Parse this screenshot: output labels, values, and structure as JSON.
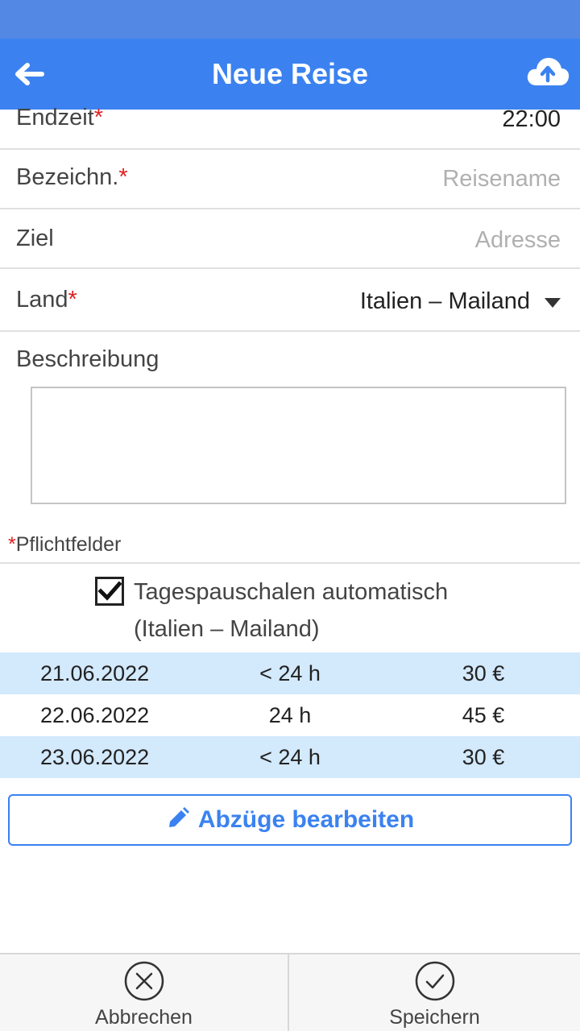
{
  "header": {
    "title": "Neue Reise",
    "back_icon": "arrow-left-icon",
    "upload_icon": "cloud-upload-icon",
    "color": "#3b82f0"
  },
  "form": {
    "endzeit": {
      "label": "Endzeit",
      "required_mark": "*",
      "value": "22:00"
    },
    "bezeichnung": {
      "label": "Bezeichn.",
      "required_mark": "*",
      "placeholder": "Reisename"
    },
    "ziel": {
      "label": "Ziel",
      "placeholder": "Adresse"
    },
    "land": {
      "label": "Land",
      "required_mark": "*",
      "value": "Italien – Mailand",
      "dropdown_icon": "caret-down-icon"
    },
    "beschreibung": {
      "label": "Beschreibung",
      "value": ""
    }
  },
  "required_note": {
    "mark": "*",
    "text": "Pflichtfelder"
  },
  "allowance": {
    "checked": true,
    "label_line1": "Tagespauschalen automatisch",
    "label_line2": "(Italien – Mailand)",
    "rows": [
      {
        "date": "21.06.2022",
        "duration": "< 24 h",
        "amount": "30 €"
      },
      {
        "date": "22.06.2022",
        "duration": "24 h",
        "amount": "45 €"
      },
      {
        "date": "23.06.2022",
        "duration": "< 24 h",
        "amount": "30 €"
      }
    ],
    "row_highlight_color": "#d3e9fc"
  },
  "deductions_button": {
    "label": "Abzüge bearbeiten",
    "icon": "pencil-icon"
  },
  "bottom_bar": {
    "cancel": {
      "label": "Abbrechen",
      "icon": "close-circle-icon"
    },
    "save": {
      "label": "Speichern",
      "icon": "check-circle-icon"
    }
  }
}
